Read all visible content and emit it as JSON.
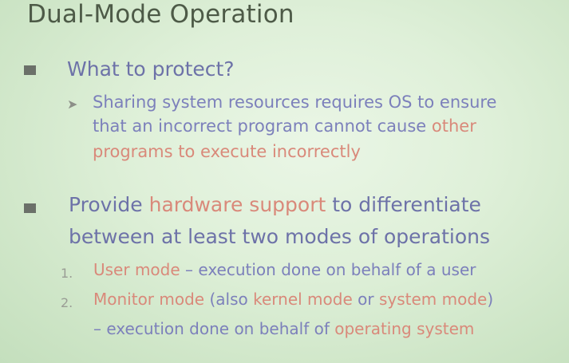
{
  "slide": {
    "title": "Dual-Mode Operation",
    "bullet1": {
      "text": "What to protect?",
      "sub": {
        "line1": "Sharing system resources requires OS to ensure",
        "line2_a": "that an incorrect program cannot cause ",
        "line2_b": "other",
        "line3": "programs to execute incorrectly"
      }
    },
    "bullet2": {
      "line1_a": "Provide ",
      "line1_b": "hardware support",
      "line1_c": " to differentiate",
      "line2": "between at least two modes of operations",
      "items": [
        {
          "num": "1.",
          "a": "User mode",
          "b": " – execution done on behalf of a user"
        },
        {
          "num": "2.",
          "a": "Monitor mode",
          "b": " (also ",
          "c": "kernel mode",
          "d": " or ",
          "e": "system mode",
          "f": ")",
          "cont_a": "– execution done on behalf of ",
          "cont_b": "operating system"
        }
      ]
    }
  }
}
